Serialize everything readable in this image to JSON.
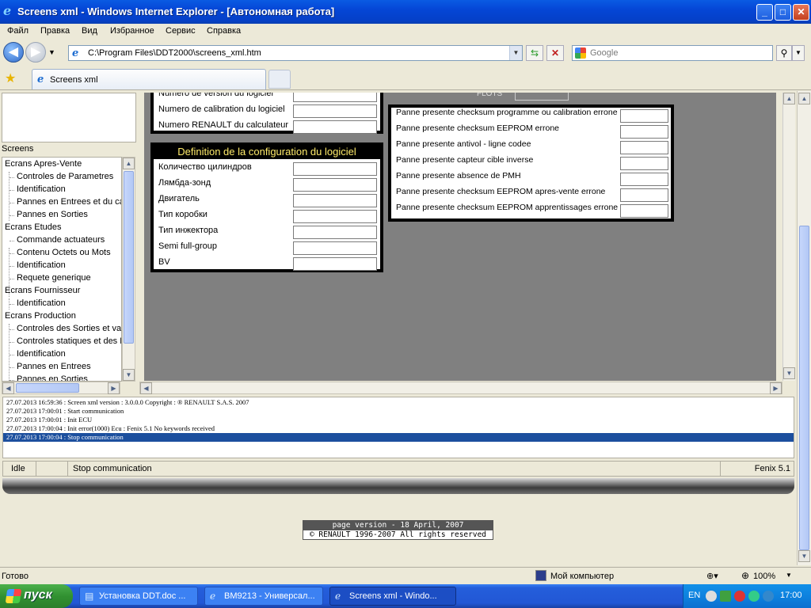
{
  "window": {
    "title": "Screens xml - Windows Internet Explorer - [Автономная работа]",
    "controls": {
      "minimize": "_",
      "maximize": "□",
      "close": "✕"
    }
  },
  "menu": [
    "Файл",
    "Правка",
    "Вид",
    "Избранное",
    "Сервис",
    "Справка"
  ],
  "address": {
    "url": "C:\\Program Files\\DDT2000\\screens_xml.htm",
    "search_placeholder": "Google"
  },
  "tab": {
    "label": "Screens xml"
  },
  "tree": {
    "header": "Screens",
    "items": [
      {
        "label": "Ecrans Apres-Vente",
        "level": 0
      },
      {
        "label": "Controles de Parametres",
        "level": 1
      },
      {
        "label": "Identification",
        "level": 1
      },
      {
        "label": "Pannes en Entrees et du ca",
        "level": 1
      },
      {
        "label": "Pannes en Sorties",
        "level": 1
      },
      {
        "label": "Ecrans Etudes",
        "level": 0
      },
      {
        "label": "Commande actuateurs",
        "level": 1
      },
      {
        "label": "Contenu Octets ou Mots",
        "level": 1
      },
      {
        "label": "Identification",
        "level": 1
      },
      {
        "label": "Requete generique",
        "level": 1
      },
      {
        "label": "Ecrans Fournisseur",
        "level": 0
      },
      {
        "label": "Identification",
        "level": 1
      },
      {
        "label": "Ecrans Production",
        "level": 0
      },
      {
        "label": "Controles des Sorties et vale",
        "level": 1
      },
      {
        "label": "Controles statiques et des E",
        "level": 1
      },
      {
        "label": "Identification",
        "level": 1
      },
      {
        "label": "Pannes en Entrees",
        "level": 1
      },
      {
        "label": "Pannes en Sorties",
        "level": 1
      }
    ]
  },
  "panel_top": {
    "rows": [
      "Numero de version du logiciel",
      "Numero de calibration du logiciel",
      "Numero RENAULT du calculateur"
    ]
  },
  "panel_config": {
    "title": "Definition de la configuration du logiciel",
    "rows": [
      "Количество цилиндров",
      "Лямбда-зонд",
      "Двигатель",
      "Тип коробки",
      "Тип инжектора",
      "Semi full-group",
      "BV"
    ]
  },
  "panel_faults": {
    "rows": [
      "Panne presente checksum programme ou calibration errone",
      "Panne presente checksum EEPROM errone",
      "Panne presente antivol - ligne codee",
      "Panne presente capteur cible inverse",
      "Panne presente absence de PMH",
      "Panne presente checksum EEPROM apres-vente errone",
      "Panne presente checksum EEPROM apprentissages errone"
    ]
  },
  "log": [
    "27.07.2013 16:59:36 : Screen xml version : 3.0.0.0   Copyright : ® RENAULT S.A.S. 2007",
    "27.07.2013 17:00:01 : Start communication",
    "27.07.2013 17:00:01 : Init ECU",
    "27.07.2013 17:00:04 : Init error(1000) Ecu : Fenix 5.1     No keywords received",
    "27.07.2013 17:00:04 : Stop communication"
  ],
  "status": {
    "state": "Idle",
    "message": "Stop communication",
    "ecu": "Fenix 5.1"
  },
  "footer": {
    "version": "page version - 18 April, 2007",
    "copyright": "© RENAULT 1996-2007 All rights reserved"
  },
  "ie_status": {
    "left": "Готово",
    "zone": "Мой компьютер",
    "zoom": "100%"
  },
  "taskbar": {
    "start": "пуск",
    "items": [
      {
        "label": "Установка DDT.doc ..."
      },
      {
        "label": "BM9213 - Универсал..."
      },
      {
        "label": "Screens xml - Windo..."
      }
    ],
    "lang": "EN",
    "clock": "17:00"
  }
}
